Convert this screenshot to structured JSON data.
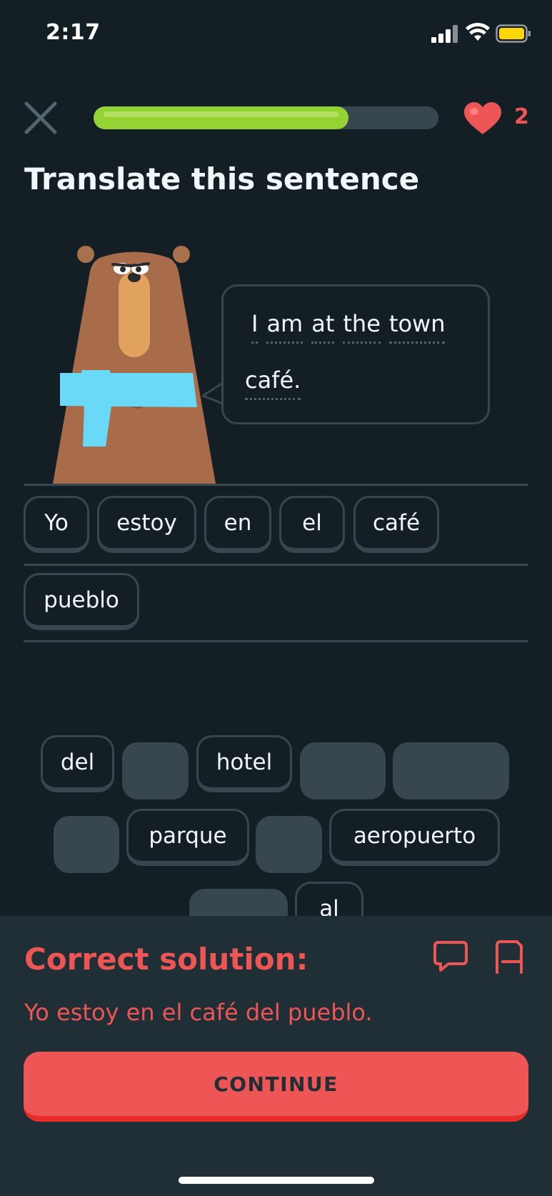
{
  "status_bar": {
    "time": "2:17"
  },
  "header": {
    "progress_percent": 74,
    "hearts": "2"
  },
  "title": "Translate this sentence",
  "prompt": {
    "line1": [
      "I",
      "am",
      "at",
      "the",
      "town"
    ],
    "line2": [
      "café."
    ]
  },
  "answer": {
    "row1": [
      "Yo",
      "estoy",
      "en",
      "el",
      "café"
    ],
    "row2": [
      "pueblo"
    ]
  },
  "word_bank": {
    "row1": [
      "del",
      "",
      "hotel",
      "",
      ""
    ],
    "row2": [
      "",
      "parque",
      "",
      "aeropuerto"
    ],
    "row3": [
      "",
      "al"
    ]
  },
  "feedback": {
    "title": "Correct solution:",
    "solution": "Yo estoy en el café del pueblo.",
    "continue_label": "CONTINUE"
  },
  "colors": {
    "background": "#131f24",
    "panel": "#202f36",
    "progress": "#93d333",
    "error": "#ee5555",
    "tile_border": "#37464f"
  }
}
